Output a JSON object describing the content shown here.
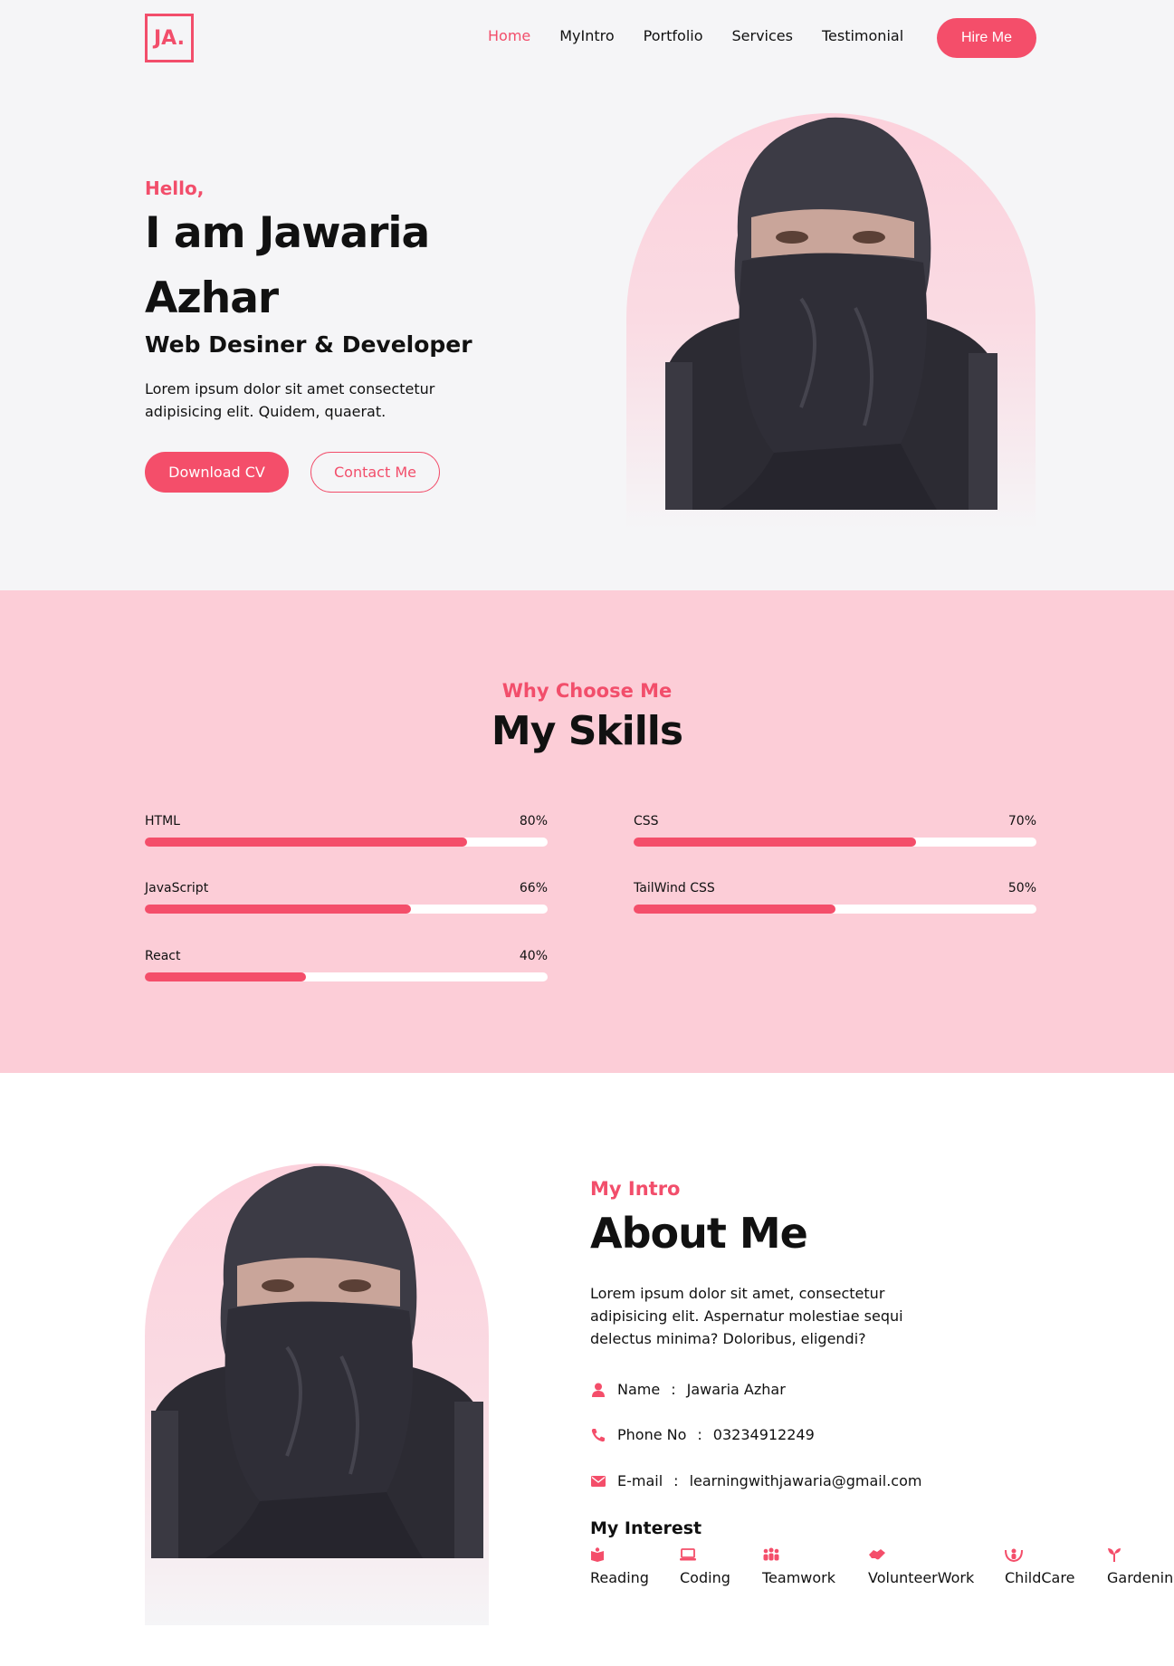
{
  "header": {
    "logo": "JA.",
    "nav": [
      "Home",
      "MyIntro",
      "Portfolio",
      "Services",
      "Testimonial"
    ],
    "hire_label": "Hire Me"
  },
  "hero": {
    "greeting": "Hello,",
    "name": "I am Jawaria Azhar",
    "role": "Web Desiner & Developer",
    "description": "Lorem ipsum dolor sit amet consectetur adipisicing elit. Quidem, quaerat.",
    "download_label": "Download CV",
    "contact_label": "Contact Me"
  },
  "skills": {
    "eyebrow": "Why Choose Me",
    "title": "My Skills",
    "items": [
      {
        "name": "HTML",
        "percent_label": "80%",
        "value": 80
      },
      {
        "name": "CSS",
        "percent_label": "70%",
        "value": 70
      },
      {
        "name": "JavaScript",
        "percent_label": "66%",
        "value": 66
      },
      {
        "name": "TailWind CSS",
        "percent_label": "50%",
        "value": 50
      },
      {
        "name": "React",
        "percent_label": "40%",
        "value": 40
      }
    ]
  },
  "about": {
    "eyebrow": "My Intro",
    "title": "About Me",
    "description": "Lorem ipsum dolor sit amet, consectetur adipisicing elit. Aspernatur molestiae sequi delectus minima? Doloribus, eligendi?",
    "info": [
      {
        "icon": "user-icon",
        "label": "Name",
        "sep": ":",
        "value": "Jawaria Azhar"
      },
      {
        "icon": "phone-icon",
        "label": "Phone No",
        "sep": ":",
        "value": "03234912249"
      },
      {
        "icon": "envelope-icon",
        "label": "E-mail",
        "sep": ":",
        "value": "learningwithjawaria@gmail.com"
      }
    ],
    "interest_title": "My Interest",
    "interests": [
      {
        "icon": "book-icon",
        "label": "Reading"
      },
      {
        "icon": "laptop-icon",
        "label": "Coding"
      },
      {
        "icon": "people-icon",
        "label": "Teamwork"
      },
      {
        "icon": "handshake-icon",
        "label": "VolunteerWork"
      },
      {
        "icon": "child-icon",
        "label": "ChildCare"
      },
      {
        "icon": "seedling-icon",
        "label": "Gardenin"
      }
    ]
  },
  "colors": {
    "accent": "#f44e6a",
    "pink_bg": "#fccdd7",
    "light_bg": "#f5f5f7"
  }
}
